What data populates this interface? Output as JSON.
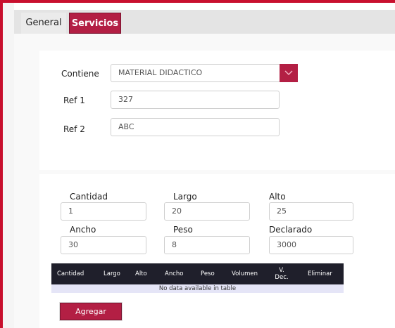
{
  "tabs": [
    {
      "label": "General"
    },
    {
      "label": "Servicios"
    }
  ],
  "form_top": {
    "contiene_label": "Contiene",
    "contiene_value": "MATERIAL DIDACTICO",
    "ref1_label": "Ref 1",
    "ref1_value": "327",
    "ref2_label": "Ref 2",
    "ref2_value": "ABC"
  },
  "form_bottom": {
    "cantidad_label": "Cantidad",
    "cantidad_value": "1",
    "largo_label": "Largo",
    "largo_value": "20",
    "alto_label": "Alto",
    "alto_value": "25",
    "ancho_label": "Ancho",
    "ancho_value": "30",
    "peso_label": "Peso",
    "peso_value": "8",
    "declarado_label": "Declarado",
    "declarado_value": "3000"
  },
  "table": {
    "headers": [
      "Cantidad",
      "Largo",
      "Alto",
      "Ancho",
      "Peso",
      "Volumen",
      "V. Dec.",
      "Eliminar"
    ],
    "empty_message": "No data available in table"
  },
  "add_button_label": "Agregar",
  "colors": {
    "accent": "#b31f44",
    "frame": "#c8102e",
    "table_header": "#1f1f2b",
    "row_bg": "#e5e5f7"
  }
}
